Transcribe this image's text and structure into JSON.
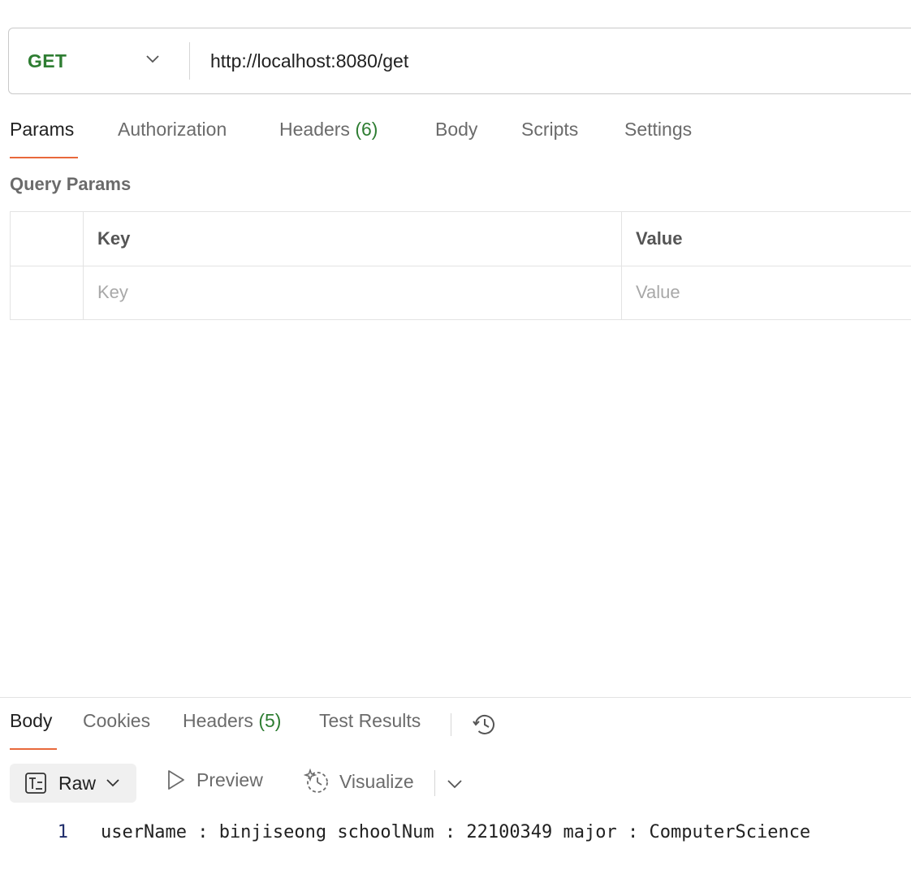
{
  "request": {
    "method": "GET",
    "url": "http://localhost:8080/get"
  },
  "request_tabs": [
    {
      "label": "Params",
      "count": "",
      "active": true
    },
    {
      "label": "Authorization",
      "count": ""
    },
    {
      "label": "Headers",
      "count": "(6)"
    },
    {
      "label": "Body",
      "count": ""
    },
    {
      "label": "Scripts",
      "count": ""
    },
    {
      "label": "Settings",
      "count": ""
    }
  ],
  "query_params": {
    "title": "Query Params",
    "columns": [
      "Key",
      "Value"
    ],
    "placeholders": {
      "key": "Key",
      "value": "Value"
    }
  },
  "response_tabs": [
    {
      "label": "Body",
      "count": "",
      "active": true
    },
    {
      "label": "Cookies",
      "count": ""
    },
    {
      "label": "Headers",
      "count": "(5)"
    },
    {
      "label": "Test Results",
      "count": ""
    }
  ],
  "response_toolbar": {
    "format_label": "Raw",
    "preview_label": "Preview",
    "visualize_label": "Visualize"
  },
  "response_body": {
    "lines": [
      {
        "number": "1",
        "text": "userName : binjiseong schoolNum : 22100349 major : ComputerScience"
      }
    ]
  },
  "icons": {
    "method_dropdown": "chevron-down-icon",
    "history": "history-icon",
    "raw_format": "text-format-icon",
    "preview": "play-icon",
    "visualize": "sparkle-icon"
  },
  "colors": {
    "method_get": "#2e7d32",
    "count_badge": "#2e7d32",
    "active_tab_underline": "#e8693b",
    "line_number": "#1f2d6b"
  }
}
